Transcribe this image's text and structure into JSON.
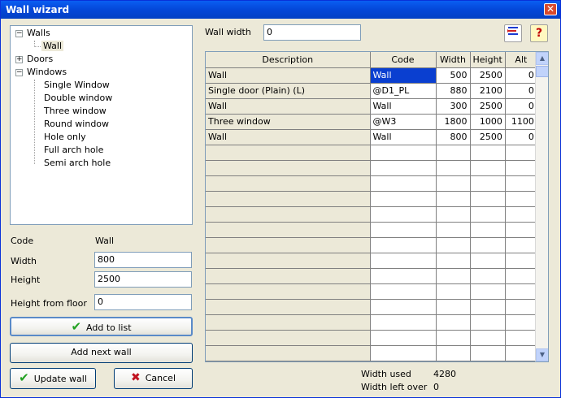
{
  "window": {
    "title": "Wall wizard",
    "close_glyph": "✕"
  },
  "tree": {
    "collapse_glyph": "−",
    "expand_glyph": "+",
    "walls": {
      "label": "Walls",
      "children": [
        "Wall"
      ]
    },
    "doors": {
      "label": "Doors"
    },
    "windows": {
      "label": "Windows",
      "children": [
        "Single Window",
        "Double window",
        "Three window",
        "Round window",
        "Hole only",
        "Full arch hole",
        "Semi arch hole"
      ]
    }
  },
  "props": {
    "code_label": "Code",
    "code_value": "Wall",
    "width_label": "Width",
    "width_value": "800",
    "height_label": "Height",
    "height_value": "2500",
    "floor_label": "Height from floor",
    "floor_value": "0"
  },
  "buttons": {
    "add_to_list": "Add to list",
    "add_next_wall": "Add next wall",
    "update_wall": "Update wall",
    "cancel": "Cancel",
    "check_glyph": "✔",
    "cancel_glyph": "✖",
    "help_glyph": "?"
  },
  "wall_width": {
    "label": "Wall width",
    "value": "0"
  },
  "grid": {
    "headers": [
      "Description",
      "Code",
      "Width",
      "Height",
      "Alt"
    ],
    "rows": [
      [
        "Wall",
        "Wall",
        "500",
        "2500",
        "0"
      ],
      [
        "Single door (Plain) (L)",
        "@D1_PL",
        "880",
        "2100",
        "0"
      ],
      [
        "Wall",
        "Wall",
        "300",
        "2500",
        "0"
      ],
      [
        "Three window",
        "@W3",
        "1800",
        "1000",
        "1100"
      ],
      [
        "Wall",
        "Wall",
        "800",
        "2500",
        "0"
      ]
    ],
    "scroll_up": "▲",
    "scroll_down": "▼"
  },
  "summary": {
    "used_label": "Width used",
    "used_value": "4280",
    "left_label": "Width left over",
    "left_value": "0"
  },
  "colors": {
    "title_bar": "#0a5ef2",
    "selection": "#0a3fd0",
    "check": "#21a121",
    "cancel": "#c1121f"
  }
}
